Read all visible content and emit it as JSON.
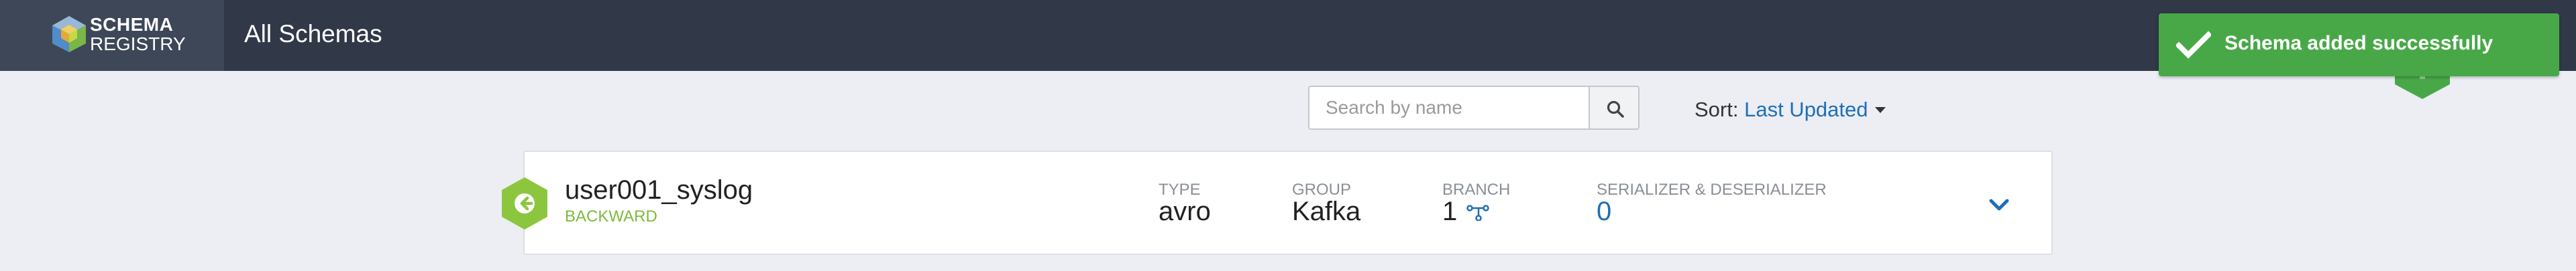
{
  "header": {
    "logo_line1": "SCHEMA",
    "logo_line2": "REGISTRY",
    "page_title": "All Schemas",
    "background_color": "#313848"
  },
  "toast": {
    "message": "Schema added successfully",
    "icon": "check-icon",
    "color": "#48a848"
  },
  "toolbar": {
    "search_placeholder": "Search by name",
    "search_value": "",
    "search_icon": "search-icon",
    "sort_label": "Sort:",
    "sort_value": "Last Updated"
  },
  "schemas": [
    {
      "name": "user001_syslog",
      "compatibility": "BACKWARD",
      "type_label": "TYPE",
      "type": "avro",
      "group_label": "GROUP",
      "group": "Kafka",
      "branch_label": "BRANCH",
      "branch": "1",
      "serdes_label": "SERIALIZER & DESERIALIZER",
      "serdes": "0",
      "badge_icon": "arrow-left-icon",
      "badge_color": "#8cc63f",
      "expand_icon": "chevron-down-icon"
    }
  ],
  "colors": {
    "accent": "#1f6fb5",
    "compatibility": "#7cba3b"
  }
}
